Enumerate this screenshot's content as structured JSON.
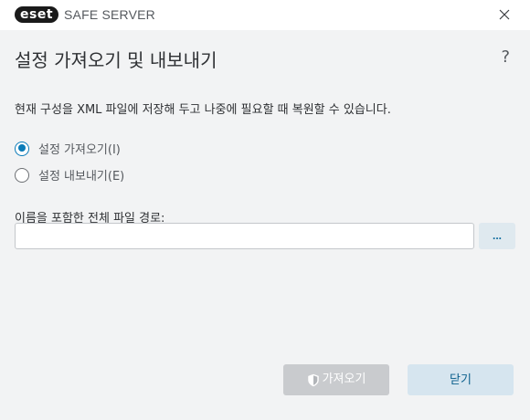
{
  "app": {
    "logo_text": "eset",
    "product_name": "SAFE SERVER"
  },
  "dialog": {
    "title": "설정 가져오기 및 내보내기",
    "help_label": "?",
    "description": "현재 구성을 XML 파일에 저장해 두고 나중에 필요할 때 복원할 수 있습니다.",
    "options": [
      {
        "label": "설정 가져오기(I)",
        "selected": true
      },
      {
        "label": "설정 내보내기(E)",
        "selected": false
      }
    ],
    "path_label": "이름을 포함한 전체 파일 경로:",
    "path_value": "",
    "browse_label": "...",
    "import_button": "가져오기",
    "import_enabled": false,
    "close_button": "닫기"
  },
  "colors": {
    "accent": "#0a7bb8",
    "background": "#f2f3f4",
    "disabled_button": "#c9cbce",
    "secondary_button": "#d6e5ef"
  },
  "icons": [
    "close-icon",
    "shield-icon"
  ]
}
